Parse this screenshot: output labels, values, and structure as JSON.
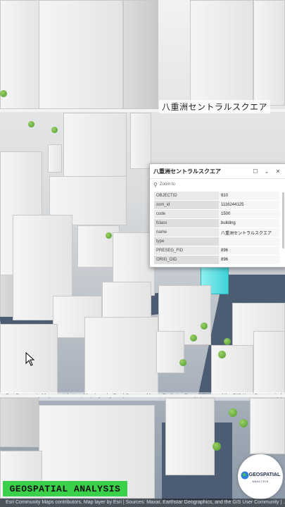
{
  "map_label": "八重洲セントラルスクエア",
  "popup": {
    "title": "八重洲セントラルスクエア",
    "zoom_label": "Zoom to",
    "attributes": [
      {
        "key": "OBJECTID",
        "value": "810"
      },
      {
        "key": "osm_id",
        "value": "1116244125"
      },
      {
        "key": "code",
        "value": "1500"
      },
      {
        "key": "fclass",
        "value": "building"
      },
      {
        "key": "name",
        "value": "八重洲セントラルスクエア"
      },
      {
        "key": "type",
        "value": ""
      },
      {
        "key": "PRESEG_FID",
        "value": "896"
      },
      {
        "key": "ORIG_OID",
        "value": "896"
      }
    ]
  },
  "attribution_text": "Esri Community Maps contributors, Map layer by Esri | Sources: Maxar, Earthstar Geographics, and the GIS User Community | ... GeoTechnologies, Inc, METI/NASA, USGS",
  "banner_text": "GEOSPATIAL ANALYSIS",
  "logo": {
    "line1": "GEOSPATIAL",
    "line2": "ANALYSIS"
  },
  "colors": {
    "highlight": "#3ed2d8",
    "banner": "#3bd049"
  }
}
